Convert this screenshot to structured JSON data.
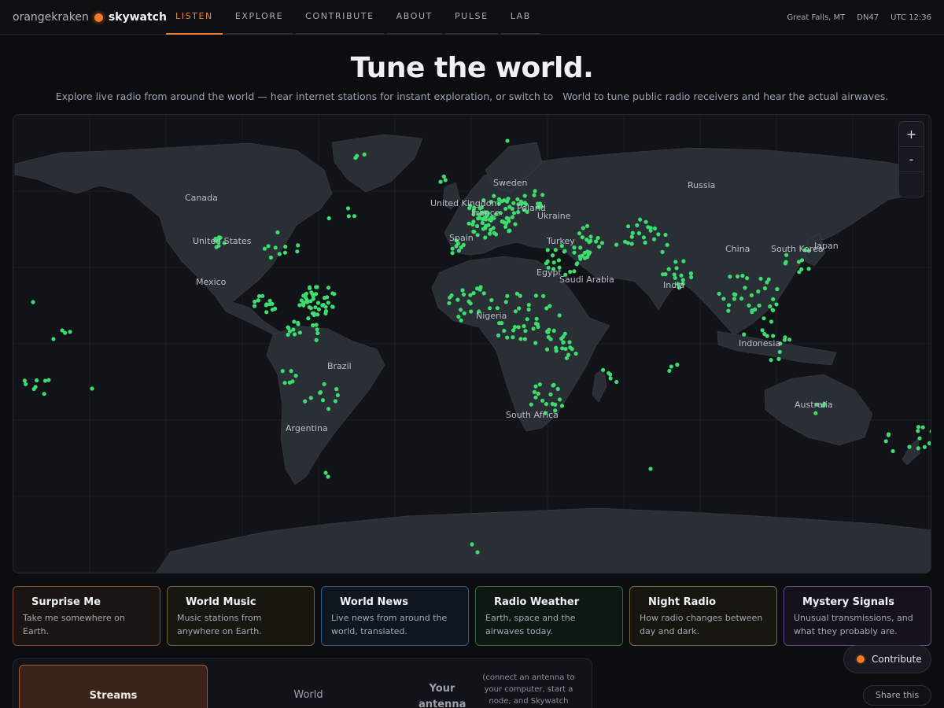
{
  "header": {
    "brand_primary": "orangekraken",
    "brand_secondary": "skywatch",
    "nav": [
      "LISTEN",
      "EXPLORE",
      "CONTRIBUTE",
      "ABOUT",
      "PULSE",
      "LAB"
    ],
    "active_nav": "LISTEN",
    "location": "Great Falls, MT",
    "grid_square": "DN47",
    "time": "UTC 12:36"
  },
  "hero": {
    "title": "Tune the world.",
    "subtitle_a": "Explore live radio from around the world — hear internet stations for instant exploration, or switch to",
    "subtitle_b": "World to tune public radio receivers and hear the actual airwaves."
  },
  "map": {
    "zoom_in": "+",
    "zoom_out": "-",
    "station_color": "#3ddc6f",
    "labels": [
      "Canada",
      "United States",
      "Mexico",
      "Brazil",
      "Argentina",
      "Sweden",
      "United Kingdom",
      "Poland",
      "Ukraine",
      "France",
      "Spain",
      "Turkey",
      "Egypt",
      "Saudi Arabia",
      "Nigeria",
      "South Africa",
      "Russia",
      "China",
      "South Korea",
      "Japan",
      "India",
      "Indonesia",
      "Australia"
    ]
  },
  "cards": [
    {
      "title": "Surprise Me",
      "desc": "Take me somewhere on Earth."
    },
    {
      "title": "World Music",
      "desc": "Music stations from anywhere on Earth."
    },
    {
      "title": "World News",
      "desc": "Live news from around the world, translated."
    },
    {
      "title": "Radio Weather",
      "desc": "Earth, space and the airwaves today."
    },
    {
      "title": "Night Radio",
      "desc": "How radio changes between day and dark."
    },
    {
      "title": "Mystery Signals",
      "desc": "Unusual transmissions, and what they probably are."
    }
  ],
  "modes": {
    "streams": "Streams",
    "world": "World",
    "antenna": "Your antenna",
    "antenna_hint": "(connect an antenna to your computer, start a node, and Skywatch"
  },
  "actions": {
    "contribute": "Contribute",
    "share": "Share this"
  }
}
